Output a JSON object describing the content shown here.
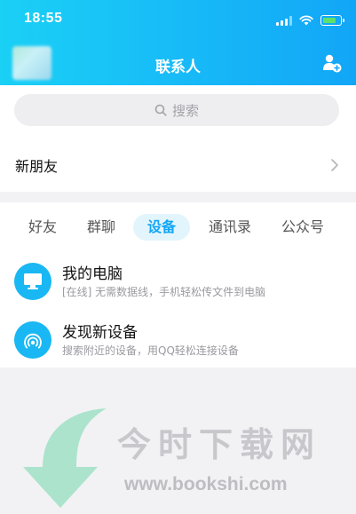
{
  "status_bar": {
    "time": "18:55"
  },
  "header": {
    "title": "联系人"
  },
  "search": {
    "placeholder": "搜索"
  },
  "new_friends": {
    "label": "新朋友"
  },
  "tabs": [
    {
      "label": "好友",
      "active": false
    },
    {
      "label": "群聊",
      "active": false
    },
    {
      "label": "设备",
      "active": true
    },
    {
      "label": "通讯录",
      "active": false
    },
    {
      "label": "公众号",
      "active": false
    }
  ],
  "devices": [
    {
      "title": "我的电脑",
      "subtitle": "[在线] 无需数据线，手机轻松传文件到电脑",
      "icon": "monitor-icon"
    },
    {
      "title": "发现新设备",
      "subtitle": "搜索附近的设备，用QQ轻松连接设备",
      "icon": "radar-icon"
    }
  ],
  "watermark": {
    "text": "今时下载网",
    "url": "www.bookshi.com"
  },
  "colors": {
    "accent": "#12a6f7",
    "header_start": "#1ad0f5",
    "icon_blue": "#19b7f3"
  }
}
